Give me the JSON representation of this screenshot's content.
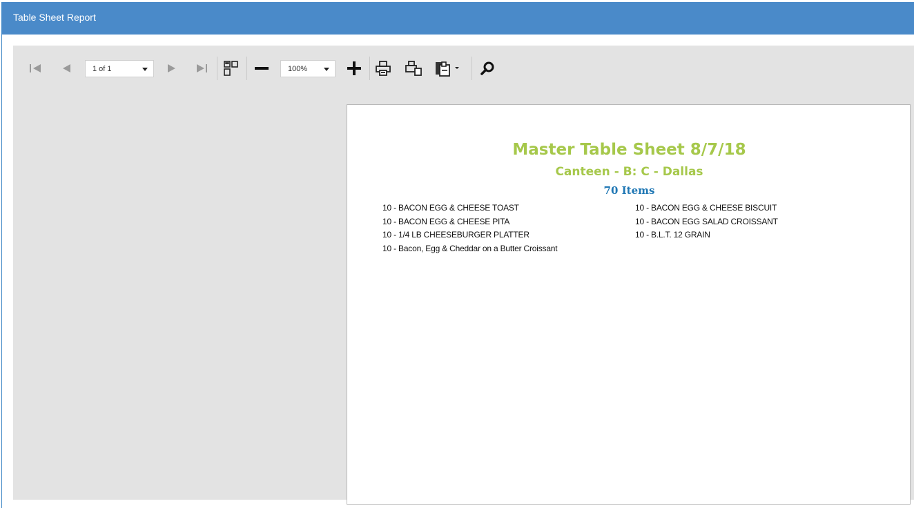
{
  "window": {
    "title": "Table Sheet Report"
  },
  "toolbar": {
    "page_selector": {
      "value": "1 of 1"
    },
    "zoom_selector": {
      "value": "100%"
    },
    "icons": [
      "first-page-icon",
      "previous-page-icon",
      "next-page-icon",
      "last-page-icon",
      "multi-page-icon",
      "zoom-out-icon",
      "zoom-in-icon",
      "print-icon",
      "print-page-icon",
      "export-icon",
      "search-icon"
    ]
  },
  "report": {
    "title": "Master Table Sheet  8/7/18",
    "subtitle": "Canteen - B: C - Dallas",
    "item_count": "70 Items",
    "items_left": [
      "10 - BACON EGG & CHEESE TOAST",
      "10 - BACON EGG & CHEESE PITA",
      "10 - 1/4 LB CHEESEBURGER PLATTER",
      "10 - Bacon, Egg & Cheddar on a Butter Croissant"
    ],
    "items_right": [
      "10 - BACON EGG & CHEESE BISCUIT",
      "10 - BACON  EGG SALAD CROISSANT",
      "10 - B.L.T. 12 GRAIN"
    ]
  },
  "colors": {
    "titlebar": "#4a8ac9",
    "report_title": "#a6c84b",
    "report_count": "#1f77b4",
    "viewer_bg": "#e3e3e3"
  }
}
